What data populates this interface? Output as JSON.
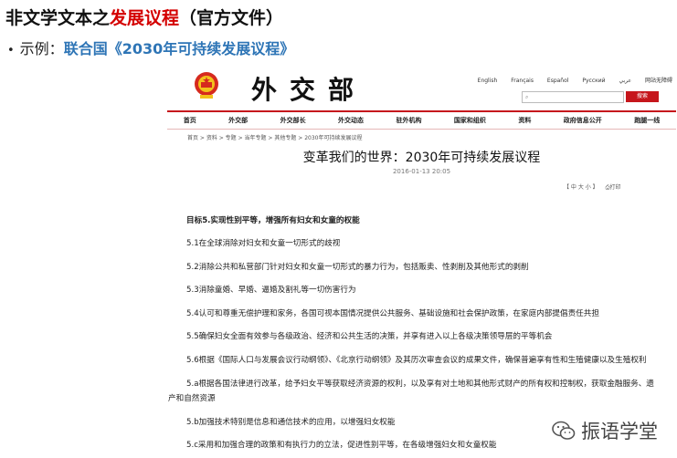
{
  "slide": {
    "title_prefix": "非文学文本之",
    "title_highlight": "发展议程",
    "title_suffix": "（官方文件）",
    "bullet": "•",
    "sub_label": "示例：",
    "sub_link": "联合国《2030年可持续发展议程》"
  },
  "site": {
    "logo": "外交部",
    "languages": [
      "English",
      "Français",
      "Español",
      "Русский",
      "عربي",
      "网站无障碍"
    ],
    "search_button": "搜索",
    "nav": [
      "首页",
      "外交部",
      "外交部长",
      "外交动态",
      "驻外机构",
      "国家和组织",
      "资料",
      "政府信息公开",
      "跑腿一线"
    ],
    "breadcrumb": "首页 > 资料 > 专题 > 当年专题 > 其他专题 > 2030年可持续发展议程",
    "article_title": "变革我们的世界：2030年可持续发展议程",
    "article_date": "2016-01-13 20:05",
    "font_tools": "【 中  大  小 】",
    "print": "打印"
  },
  "article": {
    "heading": "目标5.实现性别平等，增强所有妇女和女童的权能",
    "items": [
      "5.1在全球消除对妇女和女童一切形式的歧视",
      "5.2消除公共和私营部门针对妇女和女童一切形式的暴力行为，包括贩卖、性剥削及其他形式的剥削",
      "5.3消除童婚、早婚、逼婚及割礼等一切伤害行为",
      "5.4认可和尊重无偿护理和家务，各国可视本国情况提供公共服务、基础设施和社会保护政策，在家庭内部提倡责任共担",
      "5.5确保妇女全面有效参与各级政治、经济和公共生活的决策，并享有进入以上各级决策领导层的平等机会",
      "5.6根据《国际人口与发展会议行动纲领》、《北京行动纲领》及其历次审查会议的成果文件，确保普遍享有性和生殖健康以及生殖权利",
      "5.a根据各国法律进行改革，给予妇女平等获取经济资源的权利，以及享有对土地和其他形式财产的所有权和控制权，获取金融服务、遗",
      "产和自然资源",
      "5.b加强技术特别是信息和通信技术的应用，以增强妇女权能",
      "5.c采用和加强合理的政策和有执行力的立法，促进性别平等，在各级增强妇女和女童权能"
    ]
  },
  "watermark": {
    "text": "振语学堂",
    "icon": "wechat-icon"
  },
  "colors": {
    "highlight": "#d40000",
    "link": "#2e75b6",
    "site_red": "#c6161c"
  }
}
